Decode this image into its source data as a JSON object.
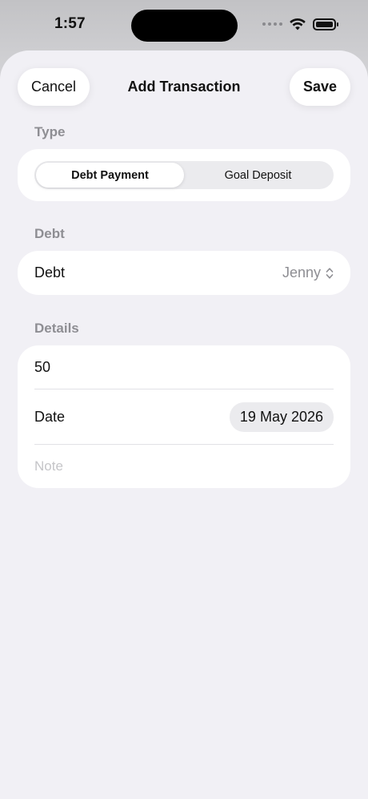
{
  "status_bar": {
    "time": "1:57",
    "icons": [
      "signal-dots-icon",
      "wifi-icon",
      "battery-icon"
    ]
  },
  "nav": {
    "cancel_label": "Cancel",
    "title": "Add Transaction",
    "save_label": "Save"
  },
  "type_section": {
    "header": "Type",
    "segments": [
      {
        "label": "Debt Payment",
        "selected": true
      },
      {
        "label": "Goal Deposit",
        "selected": false
      }
    ]
  },
  "debt_section": {
    "header": "Debt",
    "row_label": "Debt",
    "selected_value": "Jenny",
    "icon": "chevron-up-down-icon"
  },
  "details_section": {
    "header": "Details",
    "amount_value": "50",
    "date_label": "Date",
    "date_value": "19 May 2026",
    "note_placeholder": "Note",
    "note_value": ""
  },
  "colors": {
    "sheet_background": "#f1f0f5",
    "card_background": "#ffffff",
    "secondary_text": "#8e8e93",
    "placeholder_text": "#c5c5c8"
  }
}
